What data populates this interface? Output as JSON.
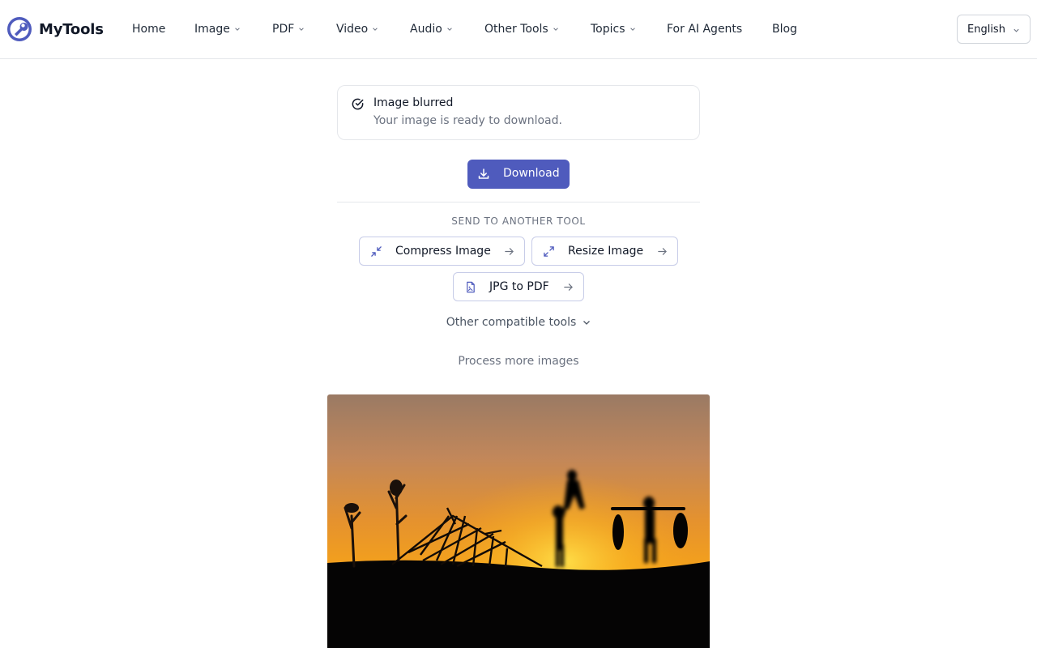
{
  "brand": {
    "name": "MyTools",
    "accent": "#4f5bbd"
  },
  "nav": {
    "items": [
      {
        "label": "Home",
        "has_dropdown": false
      },
      {
        "label": "Image",
        "has_dropdown": true
      },
      {
        "label": "PDF",
        "has_dropdown": true
      },
      {
        "label": "Video",
        "has_dropdown": true
      },
      {
        "label": "Audio",
        "has_dropdown": true
      },
      {
        "label": "Other Tools",
        "has_dropdown": true
      },
      {
        "label": "Topics",
        "has_dropdown": true
      },
      {
        "label": "For AI Agents",
        "has_dropdown": false
      },
      {
        "label": "Blog",
        "has_dropdown": false
      }
    ],
    "language": "English"
  },
  "toast": {
    "icon": "check-circle-icon",
    "title": "Image blurred",
    "message": "Your image is ready to download."
  },
  "download": {
    "label": "Download",
    "icon": "download-icon"
  },
  "send_to": {
    "heading": "SEND TO ANOTHER TOOL",
    "tools": [
      {
        "label": "Compress Image",
        "icon": "compress-arrows-icon"
      },
      {
        "label": "Resize Image",
        "icon": "expand-arrows-icon"
      },
      {
        "label": "JPG to PDF",
        "icon": "file-image-icon"
      }
    ],
    "other_label": "Other compatible tools"
  },
  "process_more": "Process more images",
  "preview": {
    "description_alt": "Blurred sunset silhouette preview"
  }
}
